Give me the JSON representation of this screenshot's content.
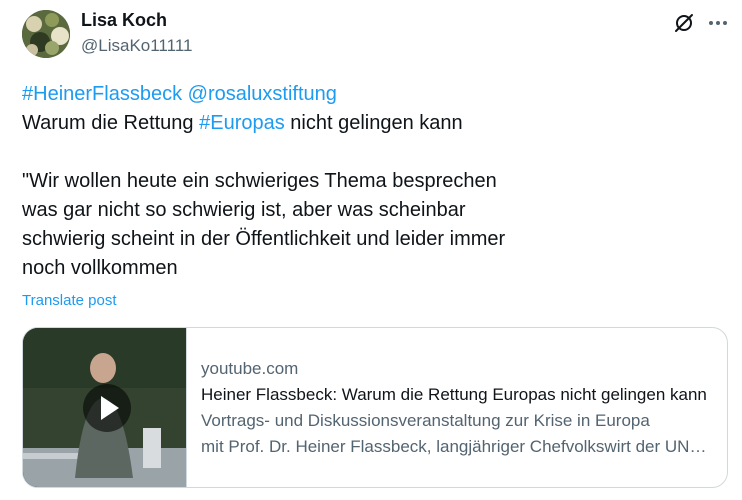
{
  "user": {
    "display_name": "Lisa Koch",
    "handle": "@LisaKo11111"
  },
  "icons": {
    "grok": "grok-icon",
    "more": "more-horizontal-icon",
    "play": "play-icon"
  },
  "tweet": {
    "line1_tags": [
      "#HeinerFlassbeck",
      "@rosaluxstiftung"
    ],
    "line2_prefix": "Warum die Rettung ",
    "line2_tag": "#Europas",
    "line2_suffix": " nicht gelingen kann",
    "quote_lines": [
      "\"Wir wollen heute ein schwieriges Thema besprechen",
      "was gar nicht so schwierig ist, aber was scheinbar",
      "schwierig scheint in der Öffentlichkeit und leider immer",
      "noch vollkommen"
    ],
    "translate_label": "Translate post"
  },
  "card": {
    "domain": "youtube.com",
    "title": "Heiner Flassbeck: Warum die Rettung Europas nicht gelingen kann",
    "description_lines": [
      "Vortrags- und Diskussionsveranstaltung zur Krise in Europa",
      "mit Prof. Dr. Heiner Flassbeck, langjähriger Chefvolkswirt der UNCTAD"
    ]
  },
  "colors": {
    "link": "#1d9bf0",
    "text": "#0f1419",
    "secondary": "#536471",
    "border": "#cfd9de"
  }
}
